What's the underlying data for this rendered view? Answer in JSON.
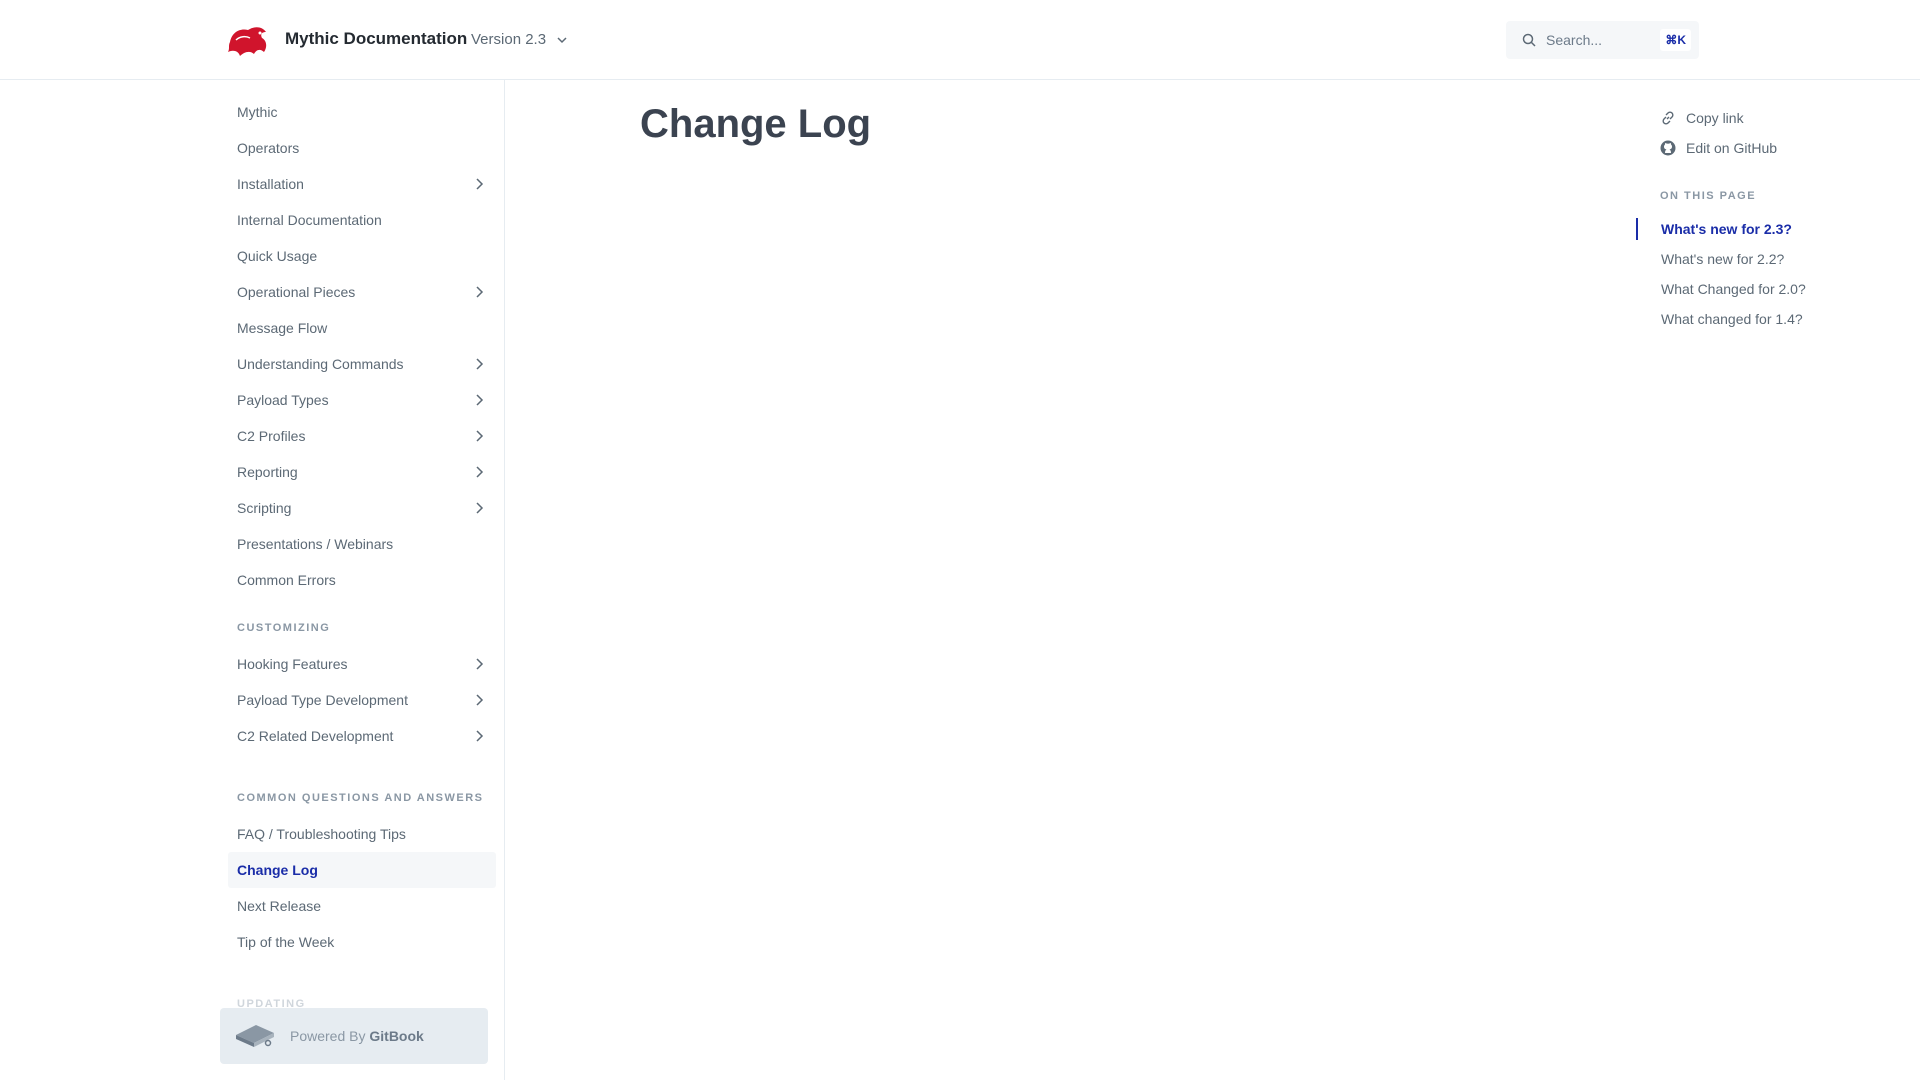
{
  "header": {
    "title": "Mythic Documentation",
    "version": "Version 2.3",
    "search_placeholder": "Search...",
    "search_shortcut": "⌘K"
  },
  "sidebar": {
    "items": [
      {
        "label": "Mythic",
        "expandable": false
      },
      {
        "label": "Operators",
        "expandable": false
      },
      {
        "label": "Installation",
        "expandable": true
      },
      {
        "label": "Internal Documentation",
        "expandable": false
      },
      {
        "label": "Quick Usage",
        "expandable": false
      },
      {
        "label": "Operational Pieces",
        "expandable": true
      },
      {
        "label": "Message Flow",
        "expandable": false
      },
      {
        "label": "Understanding Commands",
        "expandable": true
      },
      {
        "label": "Payload Types",
        "expandable": true
      },
      {
        "label": "C2 Profiles",
        "expandable": true
      },
      {
        "label": "Reporting",
        "expandable": true
      },
      {
        "label": "Scripting",
        "expandable": true
      },
      {
        "label": "Presentations / Webinars",
        "expandable": false
      },
      {
        "label": "Common Errors",
        "expandable": false
      }
    ],
    "section_customizing": "CUSTOMIZING",
    "customizing_items": [
      {
        "label": "Hooking Features",
        "expandable": true
      },
      {
        "label": "Payload Type Development",
        "expandable": true
      },
      {
        "label": "C2 Related Development",
        "expandable": true
      }
    ],
    "section_common": "COMMON QUESTIONS AND ANSWERS",
    "common_items": [
      {
        "label": "FAQ / Troubleshooting Tips",
        "expandable": false
      },
      {
        "label": "Change Log",
        "expandable": false,
        "active": true
      },
      {
        "label": "Next Release",
        "expandable": false
      },
      {
        "label": "Tip of the Week",
        "expandable": false
      }
    ],
    "section_updating": "UPDATING",
    "powered_prefix": "Powered By",
    "powered_brand": "GitBook"
  },
  "main": {
    "title": "Change Log"
  },
  "right": {
    "copy_link": "Copy link",
    "edit_github": "Edit on GitHub",
    "on_this_page": "ON THIS PAGE",
    "toc": [
      "What's new for 2.3?",
      "What's new for 2.2?",
      "What Changed for 2.0?",
      "What changed for 1.4?"
    ]
  },
  "colors": {
    "accent": "#1a2da8",
    "brand_red": "#d0142c",
    "text": "#5c6975",
    "border": "#e6ecf1"
  }
}
